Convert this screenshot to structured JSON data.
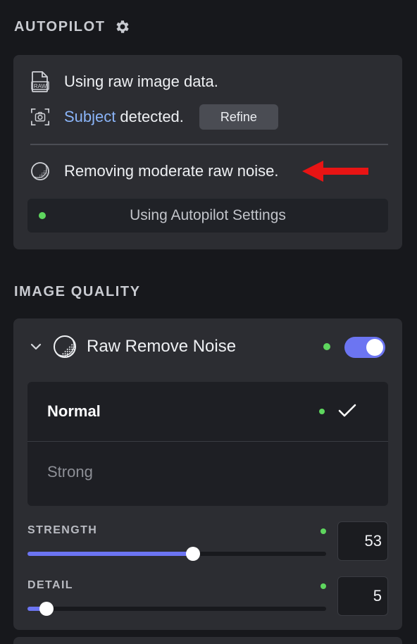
{
  "autopilot": {
    "title": "AUTOPILOT",
    "rows": {
      "raw": "Using raw image data.",
      "subject_word": "Subject",
      "subject_rest": "detected.",
      "refine_label": "Refine",
      "noise": "Removing moderate raw noise."
    },
    "status": "Using Autopilot Settings"
  },
  "image_quality": {
    "title": "IMAGE QUALITY",
    "panel_title": "Raw Remove Noise",
    "enabled": true,
    "options": [
      "Normal",
      "Strong"
    ],
    "selected_option": "Normal",
    "sliders": {
      "strength": {
        "label": "STRENGTH",
        "value": "53",
        "fraction": 0.53
      },
      "detail": {
        "label": "DETAIL",
        "value": "5",
        "fraction": 0.05
      }
    }
  },
  "colors": {
    "accent": "#6c75f2",
    "link": "#8ab4f8",
    "active_dot": "#5ed65e",
    "annotation_arrow": "#e81414"
  },
  "icons": [
    "gear-icon",
    "raw-file-icon",
    "camera-focus-icon",
    "noise-icon",
    "chevron-down-icon",
    "check-icon",
    "red-arrow-annotation"
  ]
}
